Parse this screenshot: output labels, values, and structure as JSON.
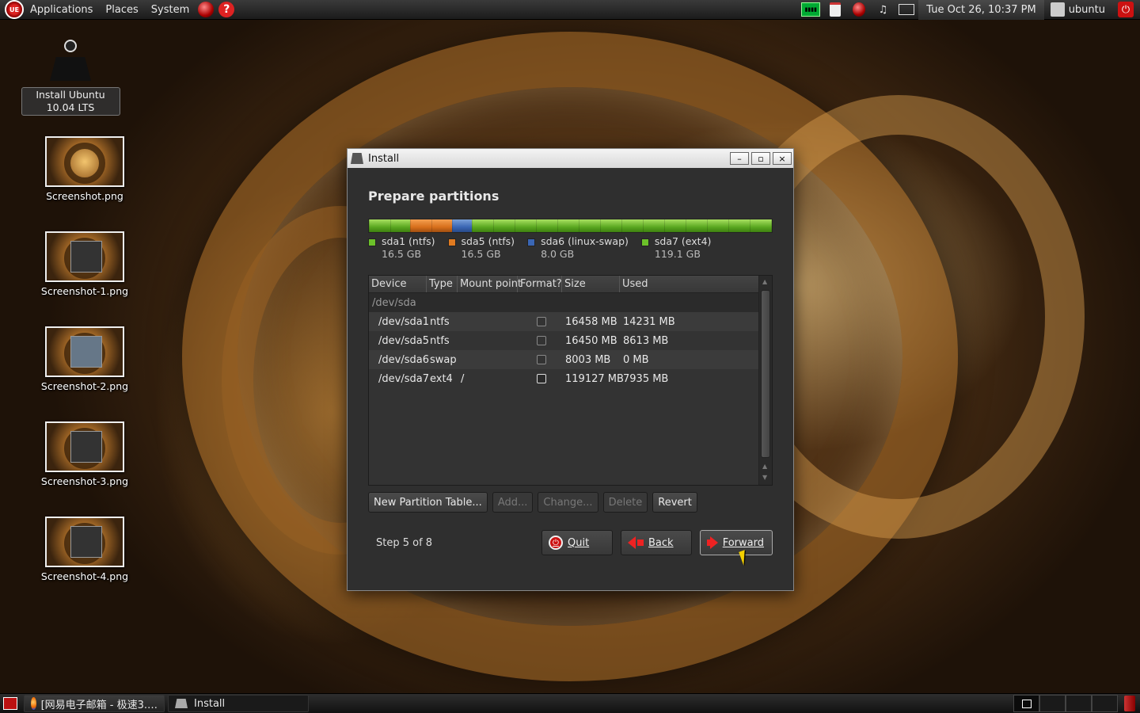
{
  "top_panel": {
    "logo": "UE",
    "menus": [
      "Applications",
      "Places",
      "System"
    ],
    "help_glyph": "?",
    "cpu_monitor_label": "▮▮▮▮",
    "clock": "Tue Oct 26, 10:37 PM",
    "user": "ubuntu",
    "power_glyph": "⏻"
  },
  "desktop_icons": [
    {
      "label": "Install Ubuntu 10.04 LTS"
    },
    {
      "label": "Screenshot.png"
    },
    {
      "label": "Screenshot-1.png"
    },
    {
      "label": "Screenshot-2.png"
    },
    {
      "label": "Screenshot-3.png"
    },
    {
      "label": "Screenshot-4.png"
    }
  ],
  "window": {
    "title": "Install",
    "buttons": {
      "minimize": "–",
      "maximize": "▫",
      "close": "×"
    },
    "heading": "Prepare partitions",
    "partition_bar": [
      {
        "name": "sda1 (ntfs)",
        "size": "16.5 GB",
        "color": "#6cc12a",
        "fraction": 0.1029
      },
      {
        "name": "sda5 (ntfs)",
        "size": "16.5 GB",
        "color": "#e07a20",
        "fraction": 0.1028
      },
      {
        "name": "sda6 (linux-swap)",
        "size": "8.0 GB",
        "color": "#3a66b4",
        "fraction": 0.05
      },
      {
        "name": "sda7 (ext4)",
        "size": "119.1 GB",
        "color": "#6cc12a",
        "fraction": 0.7443
      }
    ],
    "table": {
      "columns": [
        "Device",
        "Type",
        "Mount point",
        "Format?",
        "Size",
        "Used"
      ],
      "group": "/dev/sda",
      "rows": [
        {
          "device": "/dev/sda1",
          "type": "ntfs",
          "mount": "",
          "format": false,
          "size": "16458 MB",
          "used": "14231 MB"
        },
        {
          "device": "/dev/sda5",
          "type": "ntfs",
          "mount": "",
          "format": false,
          "size": "16450 MB",
          "used": "8613 MB"
        },
        {
          "device": "/dev/sda6",
          "type": "swap",
          "mount": "",
          "format": false,
          "size": "8003 MB",
          "used": "0 MB"
        },
        {
          "device": "/dev/sda7",
          "type": "ext4",
          "mount": "/",
          "format": false,
          "size": "119127 MB",
          "used": "7935 MB"
        }
      ]
    },
    "actions": {
      "new_table": "New Partition Table...",
      "add": "Add...",
      "change": "Change...",
      "delete": "Delete",
      "revert": "Revert"
    },
    "step": "Step 5 of 8",
    "nav": {
      "quit": "Quit",
      "back": "Back",
      "forward": "Forward"
    }
  },
  "bottom_panel": {
    "tasks": [
      {
        "label": "[网易电子邮箱 - 极速3.…"
      },
      {
        "label": "Install"
      }
    ]
  }
}
